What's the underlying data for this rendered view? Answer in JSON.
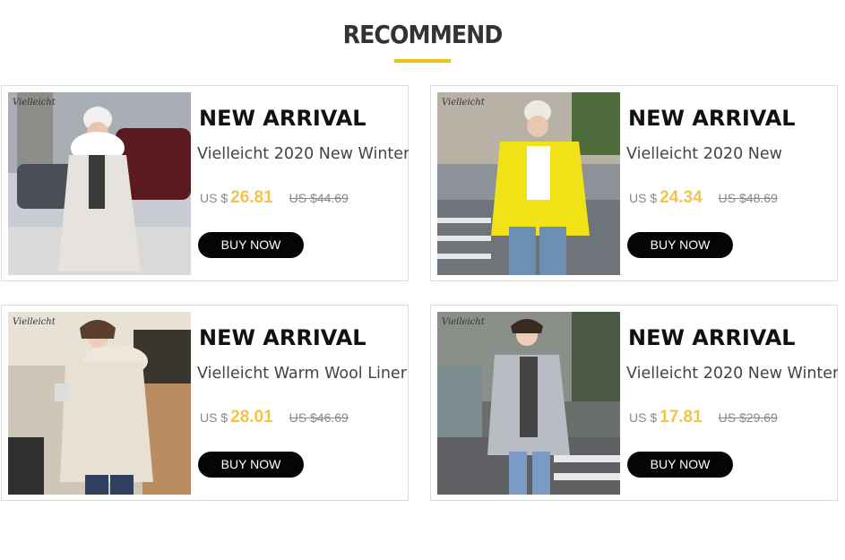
{
  "section": {
    "title": "RECOMMEND"
  },
  "accent_color": "#e8c21a",
  "price_color": "#f3c44a",
  "products": [
    {
      "brand": "Vielleicht",
      "heading": "NEW ARRIVAL",
      "name": "Vielleicht 2020 New Winter",
      "currency": "US $",
      "price": "26.81",
      "old_price": "US $44.69",
      "button": "BUY NOW",
      "jacket_color": "#e6e3de"
    },
    {
      "brand": "Vielleicht",
      "heading": "NEW ARRIVAL",
      "name": "Vielleicht 2020 New",
      "currency": "US $",
      "price": "24.34",
      "old_price": "US $48.69",
      "button": "BUY NOW",
      "jacket_color": "#f1e218"
    },
    {
      "brand": "Vielleicht",
      "heading": "NEW ARRIVAL",
      "name": "Vielleicht Warm Wool Liner",
      "currency": "US $",
      "price": "28.01",
      "old_price": "US $46.69",
      "button": "BUY NOW",
      "jacket_color": "#e7e0d3"
    },
    {
      "brand": "Vielleicht",
      "heading": "NEW ARRIVAL",
      "name": "Vielleicht 2020 New Winter",
      "currency": "US $",
      "price": "17.81",
      "old_price": "US $29.69",
      "button": "BUY NOW",
      "jacket_color": "#b9bcc2"
    }
  ]
}
